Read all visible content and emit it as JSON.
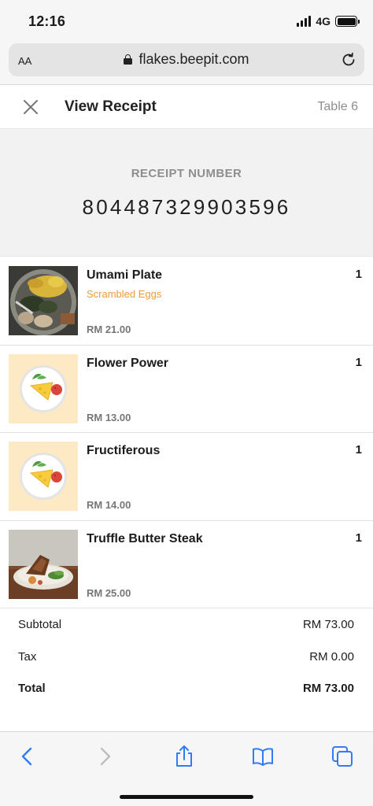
{
  "status_bar": {
    "time": "12:16",
    "network": "4G"
  },
  "browser": {
    "text_size_label": "AA",
    "url": "flakes.beepit.com"
  },
  "header": {
    "title": "View Receipt",
    "table_label": "Table 6"
  },
  "receipt": {
    "label": "RECEIPT NUMBER",
    "number": "804487329903596"
  },
  "items": [
    {
      "name": "Umami Plate",
      "variant": "Scrambled Eggs",
      "price": "RM 21.00",
      "quantity": "1",
      "image": "umami-plate-photo"
    },
    {
      "name": "Flower Power",
      "variant": "",
      "price": "RM 13.00",
      "quantity": "1",
      "image": "placeholder-plate-illustration"
    },
    {
      "name": "Fructiferous",
      "variant": "",
      "price": "RM 14.00",
      "quantity": "1",
      "image": "placeholder-plate-illustration"
    },
    {
      "name": "Truffle Butter Steak",
      "variant": "",
      "price": "RM 25.00",
      "quantity": "1",
      "image": "steak-photo"
    }
  ],
  "totals": {
    "subtotal_label": "Subtotal",
    "subtotal_value": "RM 73.00",
    "tax_label": "Tax",
    "tax_value": "RM 0.00",
    "total_label": "Total",
    "total_value": "RM 73.00"
  },
  "colors": {
    "accent": "#f29a3a",
    "ios_blue": "#2f7cf6",
    "muted": "#8e8e8e"
  }
}
